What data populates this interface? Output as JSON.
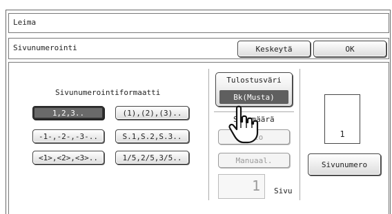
{
  "header": {
    "title": "Leima"
  },
  "subheader": {
    "title": "Sivunumerointi",
    "cancel_label": "Keskeytä",
    "ok_label": "OK"
  },
  "format": {
    "label": "Sivunumerointiformaatti",
    "options": [
      "1,2,3..",
      "(1),(2),(3)..",
      "-1-,-2-,-3-..",
      "S.1,S.2,S.3..",
      "<1>,<2>,<3>..",
      "1/5,2/5,3/5.."
    ],
    "selected": "1,2,3.."
  },
  "print_color": {
    "label": "Tulostusväri",
    "value": "Bk(Musta)"
  },
  "page_count": {
    "label": "Sivumäärä",
    "auto_label": "Auto",
    "manual_label": "Manuaal.",
    "value": "1",
    "unit": "Sivu"
  },
  "preview": {
    "page_number": "1"
  },
  "page_number_button": "Sivunumero",
  "colors": {
    "selected_bg": "#6a6a6a",
    "disabled_text": "#9a9a9a",
    "border": "#444444"
  }
}
